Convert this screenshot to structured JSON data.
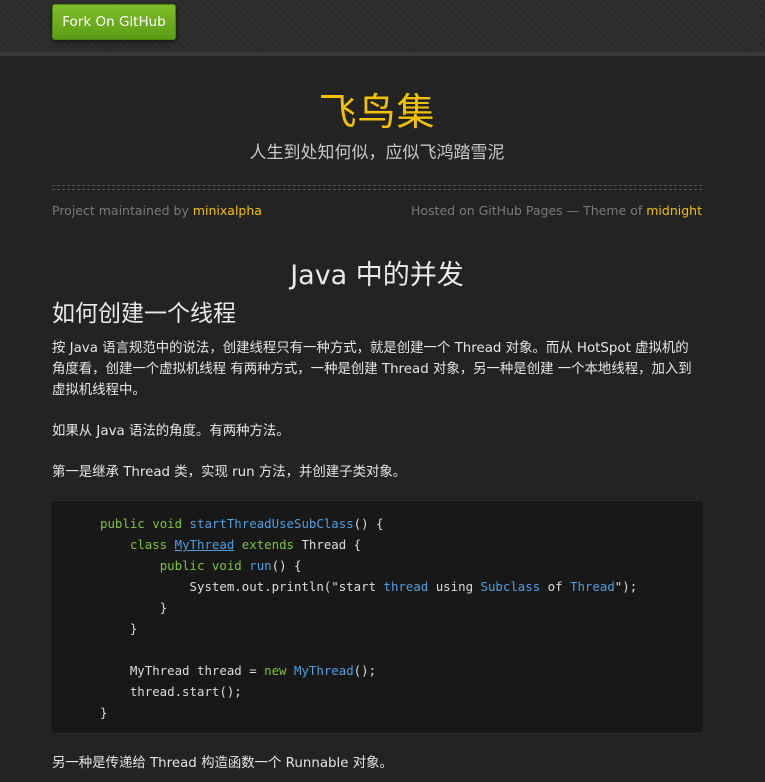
{
  "topbar": {
    "fork_label": "Fork On GitHub"
  },
  "header": {
    "title": "飞鸟集",
    "subtitle": "人生到处知何似，应似飞鸿踏雪泥"
  },
  "meta": {
    "maintained_prefix": "Project maintained by",
    "maintainer": "minixalpha",
    "hosted_prefix": "Hosted on GitHub Pages — Theme of",
    "theme": "midnight"
  },
  "article": {
    "title": "Java 中的并发",
    "section_title": "如何创建一个线程",
    "paragraphs": [
      "按 Java 语言规范中的说法，创建线程只有一种方式，就是创建一个 Thread 对象。而从 HotSpot 虚拟机的角度看，创建一个虚拟机线程 有两种方式，一种是创建 Thread 对象，另一种是创建 一个本地线程，加入到虚拟机线程中。",
      "如果从 Java 语法的角度。有两种方法。",
      "第一是继承 Thread 类，实现 run 方法，并创建子类对象。",
      "另一种是传递给 Thread 构造函数一个 Runnable 对象。"
    ],
    "code": {
      "l1_kw1": "public",
      "l1_kw2": "void",
      "l1_fn": "startThreadUseSubClass",
      "l1_rest": "() {",
      "l2_kw1": "class",
      "l2_cls": "MyThread",
      "l2_kw2": "extends",
      "l2_rest": "Thread {",
      "l3_kw1": "public",
      "l3_kw2": "void",
      "l3_fn": "run",
      "l3_rest": "() {",
      "l4_a": "System.out.println(\"start ",
      "l4_b": "thread",
      "l4_c": " using ",
      "l4_d": "Subclass",
      "l4_e": " of ",
      "l4_f": "Thread",
      "l4_g": "\");",
      "l5": "}",
      "l6": "}",
      "l8_a": "MyThread thread = ",
      "l8_kw": "new",
      "l8_fn": "MyThread",
      "l8_rest": "();",
      "l9": "thread.start();",
      "l10": "}"
    }
  },
  "colors": {
    "accent": "#f2c200",
    "background": "#232323",
    "button_green": "#6aab1f"
  }
}
